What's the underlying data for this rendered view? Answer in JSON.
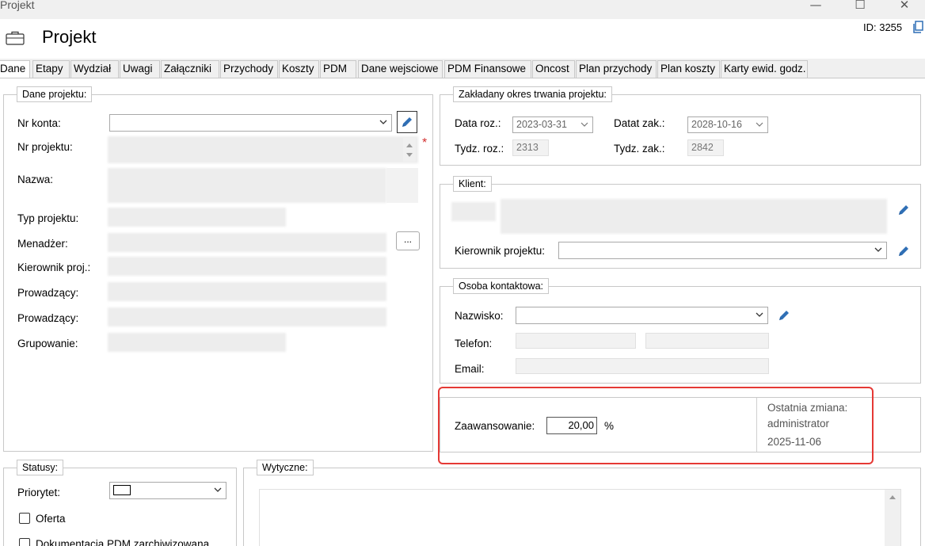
{
  "window": {
    "title": "Projekt",
    "min_glyph": "—",
    "max_glyph": "☐",
    "close_glyph": "✕"
  },
  "header": {
    "title": "Projekt",
    "id_label": "ID: 3255"
  },
  "tabs": [
    "Dane",
    "Etapy",
    "Wydział",
    "Uwagi",
    "Załączniki",
    "Przychody",
    "Koszty",
    "PDM",
    "Dane wejsciowe",
    "PDM Finansowe",
    "Oncost",
    "Plan przychody",
    "Plan koszty",
    "Karty ewid. godz."
  ],
  "dane_projektu": {
    "legend": "Dane projektu:",
    "nr_konta_label": "Nr konta:",
    "nr_projektu_label": "Nr projektu:",
    "nazwa_label": "Nazwa:",
    "typ_projektu_label": "Typ projektu:",
    "menadzer_label": "Menadżer:",
    "kierownik_label": "Kierownik proj.:",
    "prowadzacy1_label": "Prowadzący:",
    "prowadzacy2_label": "Prowadzący:",
    "grupowanie_label": "Grupowanie:",
    "required_mark": "*",
    "ellipsis_button": "..."
  },
  "okres": {
    "legend": "Zakładany okres trwania projektu:",
    "data_roz_label": "Data roz.:",
    "data_roz_value": "2023-03-31",
    "data_zak_label": "Datat zak.:",
    "data_zak_value": "2028-10-16",
    "tydz_roz_label": "Tydz. roz.:",
    "tydz_roz_value": "2313",
    "tydz_zak_label": "Tydz. zak.:",
    "tydz_zak_value": "2842"
  },
  "klient": {
    "legend": "Klient:",
    "kierownik_label": "Kierownik projektu:"
  },
  "osoba": {
    "legend": "Osoba kontaktowa:",
    "nazwisko_label": "Nazwisko:",
    "telefon_label": "Telefon:",
    "email_label": "Email:"
  },
  "zaawansowanie": {
    "label": "Zaawansowanie:",
    "value": "20,00",
    "unit": "%",
    "ostatnia_label": "Ostatnia zmiana:",
    "user": "administrator",
    "date": "2025-11-06"
  },
  "statusy": {
    "legend": "Statusy:",
    "priorytet_label": "Priorytet:",
    "oferta_label": "Oferta",
    "dokumentacja_label": "Dokumentacja PDM zarchiwizowana"
  },
  "wytyczne": {
    "legend": "Wytyczne:"
  },
  "colors": {
    "accent_pencil": "#2f6fb5",
    "highlight_red": "#e53935"
  }
}
